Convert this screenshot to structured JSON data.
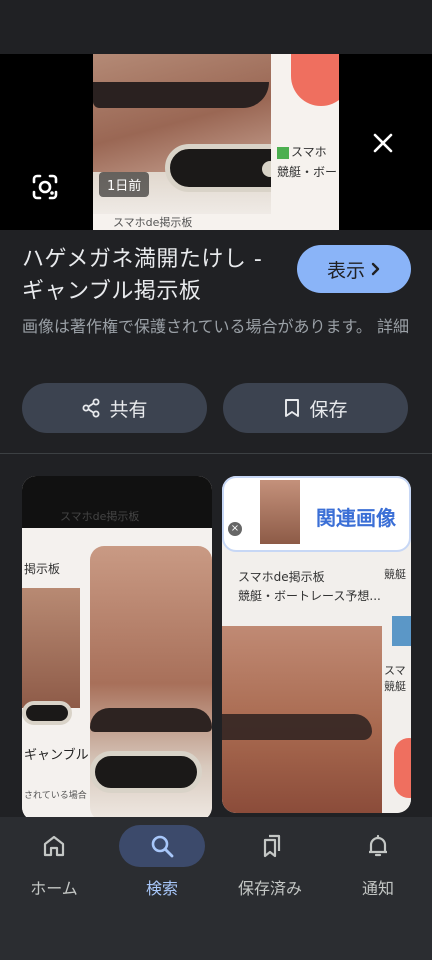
{
  "preview": {
    "time_chip": "1日前",
    "card_text_line1": "スマホ",
    "card_text_line2": "競艇・ボー",
    "bottom_text": "スマホde掲示板"
  },
  "result": {
    "title": "ハゲメガネ満開たけし - ギャンブル掲示板",
    "visit_label": "表示",
    "notice": "画像は著作権で保護されている場合があります。 詳細"
  },
  "actions": {
    "share_label": "共有",
    "save_label": "保存"
  },
  "related": {
    "left_header": "スマホde掲示板",
    "left_side_label": "掲示板",
    "left_gamble": "ギャンブル",
    "left_small": "されている場合",
    "right_label": "関連画像",
    "right_row_line1": "スマホde掲示板",
    "right_row_line2": "競艇・ボートレース予想...",
    "right_side_1": "競艇",
    "right_side_2": "スマ",
    "right_side_3": "競艇"
  },
  "nav": {
    "items": [
      {
        "label": "ホーム",
        "icon": "home-icon",
        "active": false
      },
      {
        "label": "検索",
        "icon": "search-icon",
        "active": true
      },
      {
        "label": "保存済み",
        "icon": "saved-icon",
        "active": false
      },
      {
        "label": "通知",
        "icon": "bell-icon",
        "active": false
      }
    ]
  },
  "colors": {
    "background": "#202124",
    "accent": "#8ab4f8",
    "pill": "#3c4350",
    "nav_active": "#a8c7fa"
  }
}
